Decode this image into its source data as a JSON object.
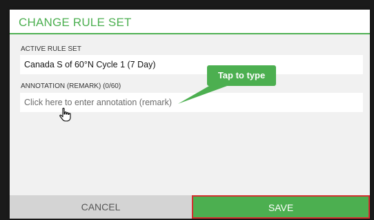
{
  "dialog": {
    "title": "CHANGE RULE SET",
    "active_rule_set": {
      "label": "ACTIVE RULE SET",
      "value": "Canada S of 60°N Cycle 1 (7 Day)"
    },
    "annotation": {
      "label": "ANNOTATION (REMARK) (0/60)",
      "placeholder": "Click here to enter annotation (remark)",
      "value": ""
    },
    "buttons": {
      "cancel": "CANCEL",
      "save": "SAVE"
    }
  },
  "tooltip": {
    "text": "Tap to type"
  },
  "colors": {
    "accent_green": "#4caf50",
    "highlight_red": "#d32f2f",
    "dialog_bg": "#f1f1f1",
    "cancel_bg": "#d4d4d4"
  },
  "icons": {
    "cursor": "hand-pointer-icon"
  }
}
